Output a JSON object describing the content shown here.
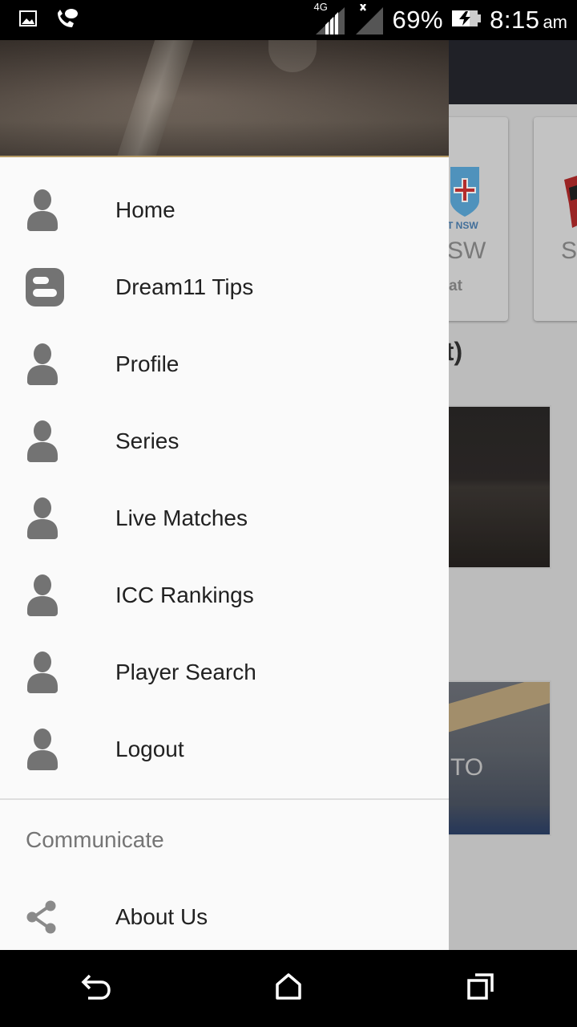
{
  "status_bar": {
    "network_type": "4G",
    "battery": "69%",
    "time": "8:15",
    "ampm": "am"
  },
  "background_app": {
    "card1_title": "SW",
    "card1_sub": "at",
    "card1_logo_text": "ET NSW",
    "card2_title": "S",
    "heading": "at)",
    "image2_text": "TO"
  },
  "drawer": {
    "items": [
      {
        "label": "Home",
        "icon": "person-icon"
      },
      {
        "label": "Dream11 Tips",
        "icon": "blogger-icon"
      },
      {
        "label": "Profile",
        "icon": "person-icon"
      },
      {
        "label": "Series",
        "icon": "person-icon"
      },
      {
        "label": "Live Matches",
        "icon": "person-icon"
      },
      {
        "label": "ICC Rankings",
        "icon": "person-icon"
      },
      {
        "label": "Player Search",
        "icon": "person-icon"
      },
      {
        "label": "Logout",
        "icon": "person-icon"
      }
    ],
    "section_title": "Communicate",
    "section_items": [
      {
        "label": "About Us",
        "icon": "share-icon"
      }
    ]
  },
  "colors": {
    "drawer_bg": "#fafafa",
    "icon_gray": "#737373",
    "text_primary": "#212121",
    "text_secondary": "#757575",
    "toolbar_dark": "#25262d",
    "header_border": "#b69c67"
  }
}
